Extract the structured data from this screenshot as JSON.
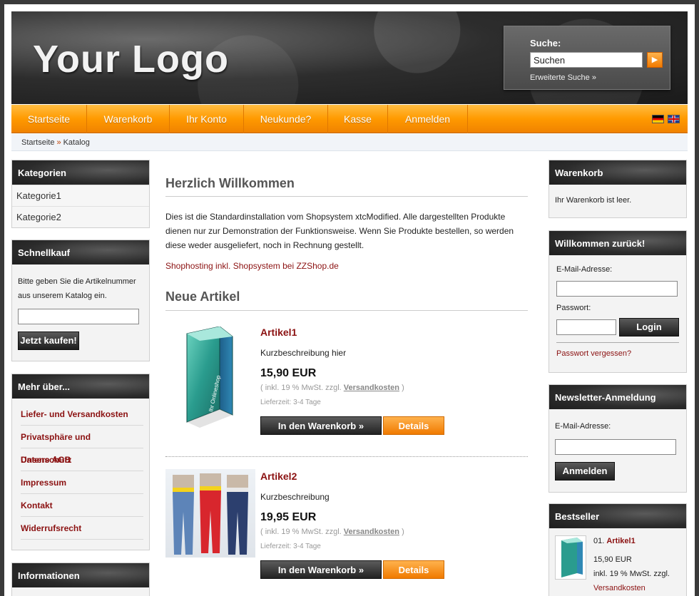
{
  "header": {
    "logo_text": "Your Logo",
    "search": {
      "label": "Suche:",
      "value": "Suchen",
      "go_icon": "arrow-right-icon",
      "advanced_label": "Erweiterte Suche »"
    }
  },
  "nav": {
    "items": [
      "Startseite",
      "Warenkorb",
      "Ihr Konto",
      "Neukunde?",
      "Kasse",
      "Anmelden"
    ],
    "flags": [
      "flag-de-icon",
      "flag-en-icon"
    ]
  },
  "breadcrumb": {
    "items": [
      "Startseite",
      "Katalog"
    ],
    "separator": "»"
  },
  "left": {
    "categories": {
      "title": "Kategorien",
      "items": [
        "Kategorie1",
        "Kategorie2"
      ]
    },
    "quickbuy": {
      "title": "Schnellkauf",
      "text": "Bitte geben Sie die Artikelnummer aus unserem Katalog ein.",
      "button": "Jetzt kaufen!"
    },
    "more": {
      "title": "Mehr über...",
      "items": [
        "Liefer- und Versandkosten",
        "Privatsphäre und Datenschutz",
        "Unsere AGB",
        "Impressum",
        "Kontakt",
        "Widerrufsrecht"
      ]
    },
    "info": {
      "title": "Informationen"
    }
  },
  "main": {
    "welcome_title": "Herzlich Willkommen",
    "welcome_text": "Dies ist die Standardinstallation vom Shopsystem xtcModified. Alle dargestellten Produkte dienen nur zur Demonstration der Funktionsweise. Wenn Sie Produkte bestellen, so werden diese weder ausgeliefert, noch in Rechnung gestellt.",
    "shop_link": "Shophosting inkl. Shopsystem bei ZZShop.de",
    "new_title": "Neue Artikel",
    "products": [
      {
        "title": "Artikel1",
        "desc": "Kurzbeschreibung hier",
        "price": "15,90 EUR",
        "tax_prefix": "( inkl. 19 % MwSt. zzgl.",
        "tax_link": "Versandkosten",
        "tax_suffix": ")",
        "delivery": "Lieferzeit: 3-4 Tage",
        "cart_button": "In den Warenkorb »",
        "details_button": "Details",
        "image": "software-box-image"
      },
      {
        "title": "Artikel2",
        "desc": "Kurzbeschreibung",
        "price": "19,95 EUR",
        "tax_prefix": "( inkl. 19 % MwSt. zzgl.",
        "tax_link": "Versandkosten",
        "tax_suffix": ")",
        "delivery": "Lieferzeit: 3-4 Tage",
        "cart_button": "In den Warenkorb »",
        "details_button": "Details",
        "image": "jeans-image"
      }
    ],
    "box_image_text": "Ihr Onlineshop"
  },
  "right": {
    "cart": {
      "title": "Warenkorb",
      "text": "Ihr Warenkorb ist leer."
    },
    "login": {
      "title": "Willkommen zurück!",
      "email_label": "E-Mail-Adresse:",
      "password_label": "Passwort:",
      "button": "Login",
      "forgot": "Passwort vergessen?"
    },
    "newsletter": {
      "title": "Newsletter-Anmeldung",
      "email_label": "E-Mail-Adresse:",
      "button": "Anmelden"
    },
    "bestseller": {
      "title": "Bestseller",
      "rank": "01.",
      "name": "Artikel1",
      "price": "15,90 EUR",
      "tax": "inkl. 19 % MwSt. zzgl.",
      "shipping": "Versandkosten"
    }
  },
  "colors": {
    "accent": "#ff9a00",
    "link": "#8b1111",
    "header_dark": "#2b2b2b"
  }
}
